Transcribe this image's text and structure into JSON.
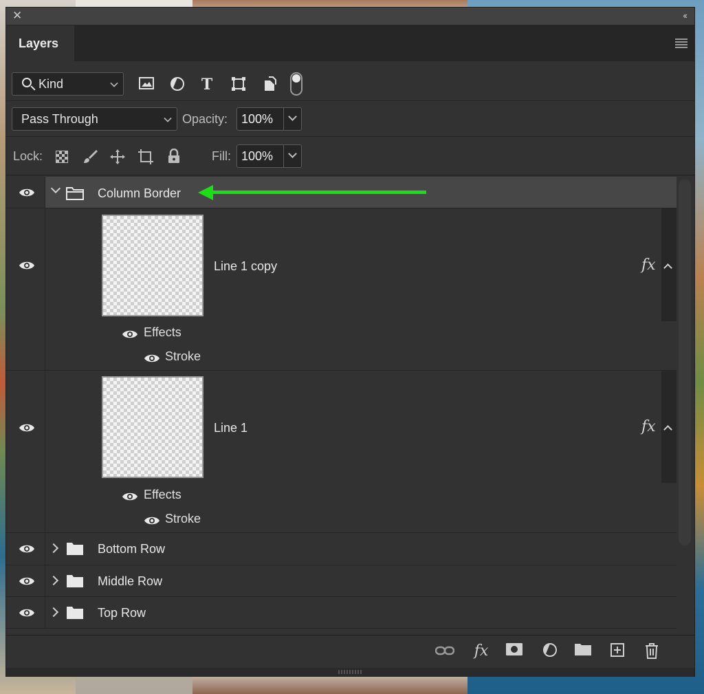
{
  "panel": {
    "close_glyph": "✕",
    "collapse_glyph": "‹‹",
    "tab_label": "Layers"
  },
  "filter": {
    "kind_label": "Kind",
    "icons": [
      "image-filter-icon",
      "adjustment-filter-icon",
      "type-filter-icon",
      "shape-filter-icon",
      "smart-object-filter-icon"
    ],
    "type_glyph": "T"
  },
  "blend": {
    "mode": "Pass Through",
    "opacity_label": "Opacity:",
    "opacity_value": "100%"
  },
  "lock": {
    "label": "Lock:",
    "fill_label": "Fill:",
    "fill_value": "100%"
  },
  "layers": {
    "group_open": {
      "name": "Column Border",
      "expanded": true,
      "selected": true
    },
    "children": [
      {
        "name": "Line 1 copy",
        "fx": "fx",
        "effects_label": "Effects",
        "stroke_label": "Stroke"
      },
      {
        "name": "Line 1",
        "fx": "fx",
        "effects_label": "Effects",
        "stroke_label": "Stroke"
      }
    ],
    "groups_collapsed": [
      {
        "name": "Bottom Row"
      },
      {
        "name": "Middle Row"
      },
      {
        "name": "Top Row"
      }
    ]
  },
  "footer": {
    "fx_label": "fx",
    "icons": [
      "link-layers-icon",
      "add-style-icon",
      "add-mask-icon",
      "new-adjustment-icon",
      "new-group-icon",
      "new-layer-icon",
      "delete-layer-icon"
    ]
  },
  "colors": {
    "panel_bg": "#323232",
    "selected_row": "#474747",
    "annotation_arrow": "#1adf14"
  }
}
